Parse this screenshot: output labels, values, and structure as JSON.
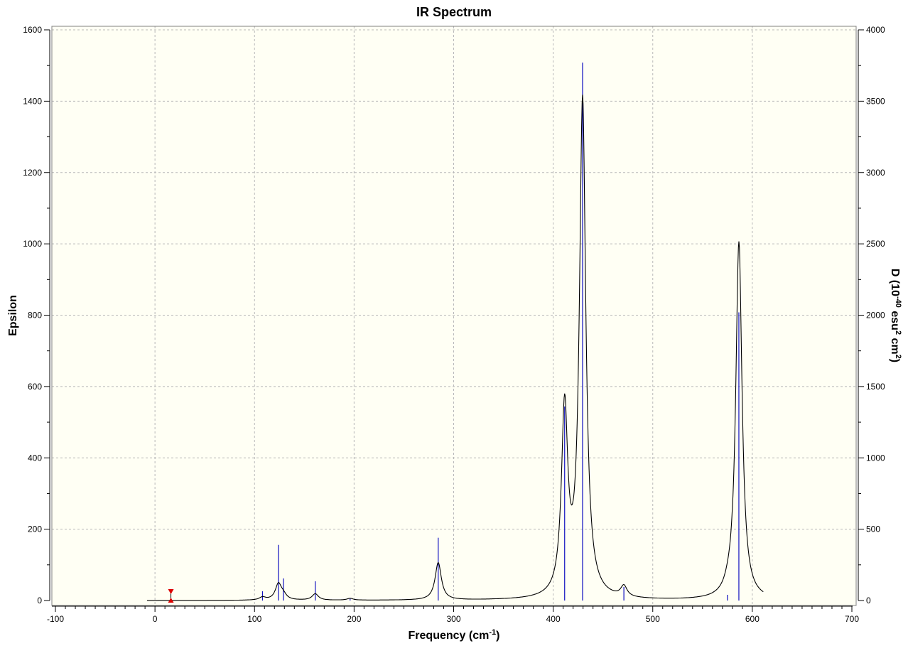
{
  "chart_data": {
    "type": "line",
    "title": "IR Spectrum",
    "xlabel": {
      "main": "Frequency (cm",
      "sup": "-1",
      "tail": ")"
    },
    "ylabel": "Epsilon",
    "ylabel_right": {
      "p1": "D (10",
      "sup1": "-40",
      "p2": " esu",
      "sup2": "2",
      "p3": " cm",
      "sup3": "2",
      "p4": ")"
    },
    "xlim": [
      -100,
      700
    ],
    "ylim": [
      0,
      1600
    ],
    "ylim_right": [
      0,
      4000
    ],
    "x_ticks": [
      -100,
      0,
      100,
      200,
      300,
      400,
      500,
      600,
      700
    ],
    "x_tick_labels": [
      "-100",
      "0",
      "100",
      "200",
      "300",
      "400",
      "500",
      "600",
      "700"
    ],
    "y_ticks": [
      0,
      200,
      400,
      600,
      800,
      1000,
      1200,
      1400,
      1600
    ],
    "y_tick_labels": [
      "0",
      "200",
      "400",
      "600",
      "800",
      "1000",
      "1200",
      "1400",
      "1600"
    ],
    "y_right_ticks": [
      0,
      500,
      1000,
      1500,
      2000,
      2500,
      3000,
      3500,
      4000
    ],
    "y_right_tick_labels": [
      "0",
      "500",
      "1000",
      "1500",
      "2000",
      "2500",
      "3000",
      "3500",
      "4000"
    ],
    "grid": true,
    "colors": {
      "background": "#fffff4",
      "spectrum": "#000000",
      "sticks": "#1010c0",
      "marker": "#dd0000"
    },
    "marker_x": 16,
    "spectrum_range": [
      -8,
      611
    ],
    "series": [
      {
        "kind": "spectrum",
        "peaks": [
          {
            "x": 108,
            "eps": 8
          },
          {
            "x": 124,
            "eps": 45
          },
          {
            "x": 129,
            "eps": 12
          },
          {
            "x": 161,
            "eps": 18
          },
          {
            "x": 196,
            "eps": 5
          },
          {
            "x": 284.5,
            "eps": 105
          },
          {
            "x": 411.5,
            "eps": 520
          },
          {
            "x": 429.5,
            "eps": 1395
          },
          {
            "x": 471,
            "eps": 30
          },
          {
            "x": 575,
            "eps": 8
          },
          {
            "x": 586.5,
            "eps": 1005
          }
        ],
        "hwhm": 3.8
      },
      {
        "kind": "sticks",
        "x": [
          108,
          124,
          129,
          161,
          196,
          284.5,
          411.5,
          429.5,
          471,
          575,
          586.5
        ],
        "d": [
          65,
          390,
          155,
          135,
          15,
          440,
          1360,
          3770,
          95,
          40,
          2020
        ]
      }
    ]
  }
}
